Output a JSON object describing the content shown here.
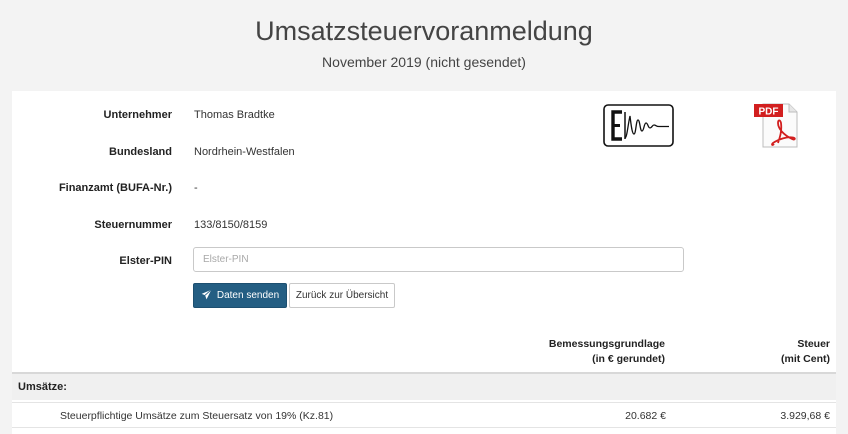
{
  "header": {
    "title": "Umsatzsteuervoranmeldung",
    "subtitle": "November 2019 (nicht gesendet)"
  },
  "form": {
    "unternehmer": {
      "label": "Unternehmer",
      "value": "Thomas Bradtke"
    },
    "bundesland": {
      "label": "Bundesland",
      "value": "Nordrhein-Westfalen"
    },
    "finanzamt": {
      "label": "Finanzamt (BUFA-Nr.)",
      "value": "-"
    },
    "steuernummer": {
      "label": "Steuernummer",
      "value": "133/8150/8159"
    },
    "pin": {
      "label": "Elster-PIN",
      "value": "",
      "placeholder": "Elster-PIN"
    }
  },
  "buttons": {
    "send_label": "Daten senden",
    "send_icon": "paper-plane-icon",
    "back_label": "Zurück zur Übersicht"
  },
  "logos": {
    "elster": "elster-logo",
    "pdf": {
      "icon": "pdf-icon",
      "text": "PDF"
    }
  },
  "table": {
    "headers": {
      "base_line1": "Bemessungsgrundlage",
      "base_line2": "(in € gerundet)",
      "tax_line1": "Steuer",
      "tax_line2": "(mit Cent)"
    },
    "sections": [
      {
        "label": "Umsätze:",
        "rows": [
          {
            "description": "Steuerpflichtige Umsätze zum Steuersatz von 19% (Kz.81)",
            "base": "20.682 €",
            "tax": "3.929,68 €"
          }
        ]
      }
    ]
  },
  "colors": {
    "primary": "#245e83",
    "background": "#f3f3f3",
    "panel": "#ffffff",
    "pdf_red": "#d21f1f"
  }
}
